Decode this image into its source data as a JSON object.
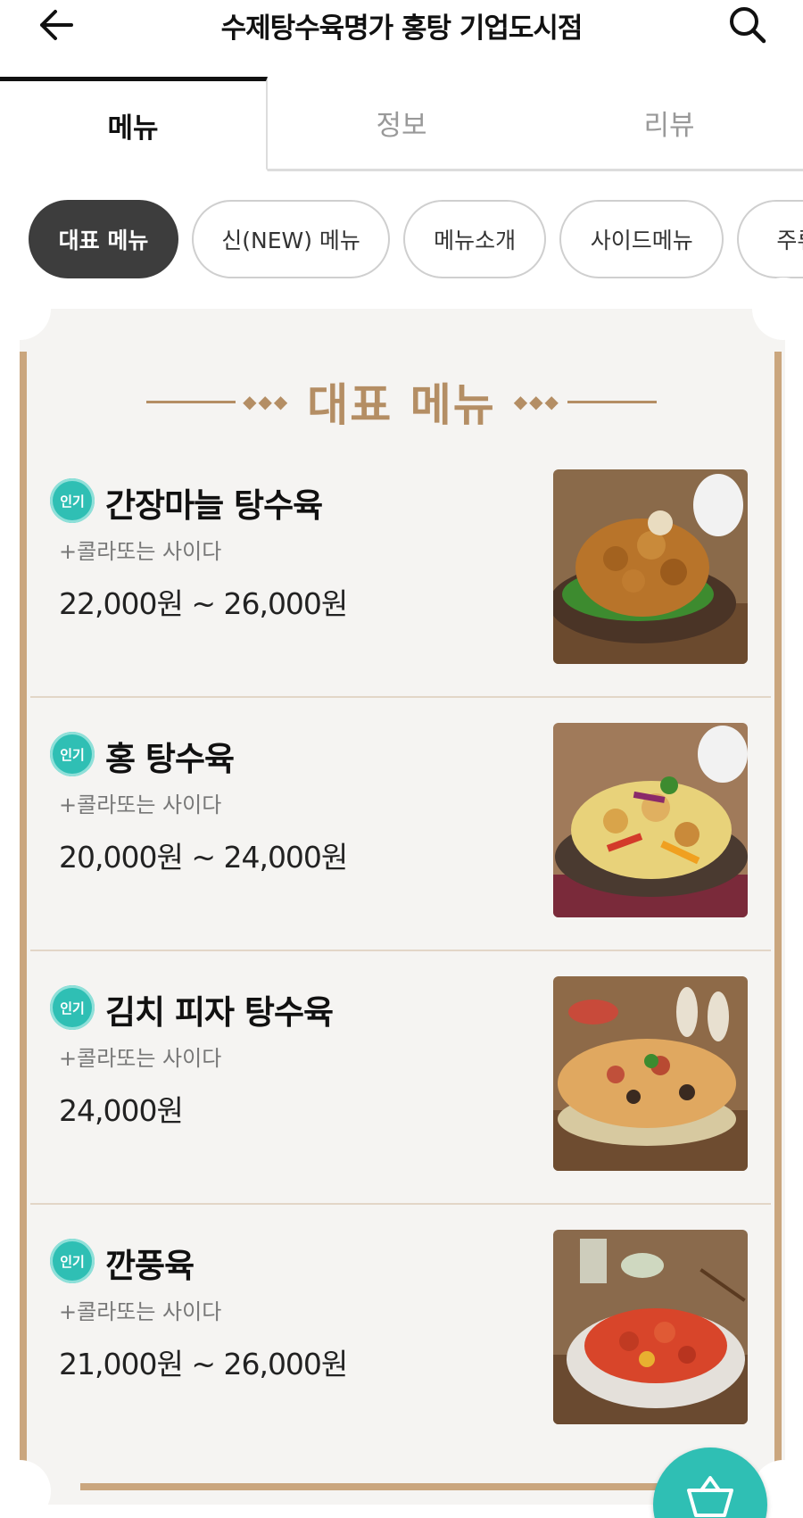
{
  "header": {
    "title": "수제탕수육명가 홍탕 기업도시점",
    "back_icon": "arrow-left-icon",
    "search_icon": "search-icon"
  },
  "tabs": [
    {
      "label": "메뉴",
      "active": true
    },
    {
      "label": "정보",
      "active": false
    },
    {
      "label": "리뷰",
      "active": false
    }
  ],
  "categories": [
    {
      "label": "대표 메뉴",
      "active": true
    },
    {
      "label": "신(NEW) 메뉴",
      "active": false
    },
    {
      "label": "메뉴소개",
      "active": false
    },
    {
      "label": "사이드메뉴",
      "active": false
    },
    {
      "label": "주류메뉴",
      "active": false
    }
  ],
  "section": {
    "title": "대표 메뉴",
    "accent_color": "#b48e64"
  },
  "items": [
    {
      "badge": "인기",
      "name": "간장마늘 탕수육",
      "desc": "+콜라또는 사이다",
      "price": "22,000원 ~ 26,000원",
      "photo": "soy-garlic-sweet-sour-pork"
    },
    {
      "badge": "인기",
      "name": "홍 탕수육",
      "desc": "+콜라또는 사이다",
      "price": "20,000원 ~ 24,000원",
      "photo": "hong-sweet-sour-pork"
    },
    {
      "badge": "인기",
      "name": "김치 피자 탕수육",
      "desc": "+콜라또는 사이다",
      "price": "24,000원",
      "photo": "kimchi-pizza-sweet-sour-pork"
    },
    {
      "badge": "인기",
      "name": "깐풍육",
      "desc": "+콜라또는 사이다",
      "price": "21,000원 ~ 26,000원",
      "photo": "kkanpung-pork"
    }
  ],
  "cart": {
    "icon": "shopping-basket-icon",
    "color": "#2fbfb4"
  }
}
